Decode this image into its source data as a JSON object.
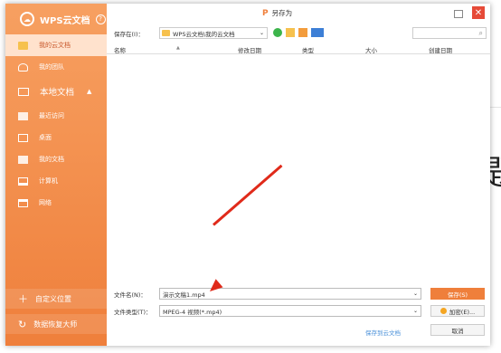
{
  "sidebar": {
    "brand": "WPS云文档",
    "help_icon": "help-icon",
    "items": [
      {
        "label": "我的云文档",
        "icon": "cloud-folder-icon",
        "active": true
      },
      {
        "label": "我的团队",
        "icon": "team-icon",
        "active": false
      }
    ],
    "local_section": "本地文档",
    "local_items": [
      {
        "label": "最近访问",
        "icon": "recent-icon"
      },
      {
        "label": "桌面",
        "icon": "desktop-icon"
      },
      {
        "label": "我的文档",
        "icon": "documents-icon"
      },
      {
        "label": "计算机",
        "icon": "computer-icon"
      },
      {
        "label": "网络",
        "icon": "network-icon"
      }
    ],
    "custom_location": "自定义位置",
    "data_recovery": "数据恢复大师"
  },
  "window": {
    "title": "另存为",
    "maximize_icon": "maximize-icon",
    "close_icon": "close-icon"
  },
  "toolbar": {
    "save_in_label": "保存在(I)：",
    "path_value": "WPS云文档\\我的云文档",
    "search_placeholder": ""
  },
  "columns": [
    "名称",
    "修改日期",
    "类型",
    "大小",
    "创建日期"
  ],
  "bottom": {
    "filename_label": "文件名(N)：",
    "filename_value": "演示文稿1.mp4",
    "filetype_label": "文件类型(T)：",
    "filetype_value": "MPEG-4 视频(*.mp4)",
    "save_button": "保存(S)",
    "encrypt_button": "加密(E)...",
    "save_to_cloud": "保存到云文档",
    "cancel_button": "取消"
  },
  "colors": {
    "accent": "#ef7f3b",
    "sidebar_active_bg": "#ffe2cd",
    "close": "#e64a38",
    "arrow": "#e02a1a",
    "link": "#4a90d9"
  }
}
